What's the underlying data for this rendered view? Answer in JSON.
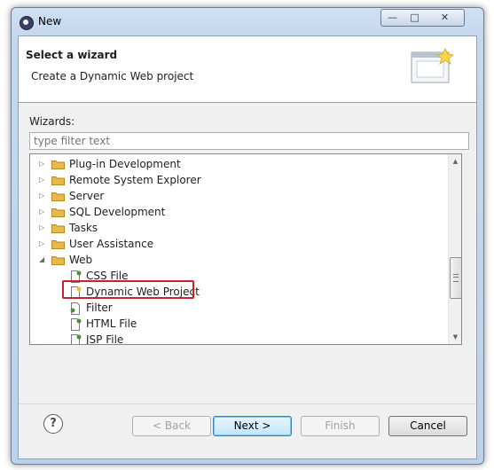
{
  "window": {
    "title": "New"
  },
  "header": {
    "title": "Select a wizard",
    "description": "Create a Dynamic Web project"
  },
  "wizards_label": "Wizards:",
  "filter": {
    "placeholder": "type filter text",
    "value": ""
  },
  "tree": {
    "items": [
      {
        "label": "Plug-in Development",
        "type": "folder",
        "expanded": false
      },
      {
        "label": "Remote System Explorer",
        "type": "folder",
        "expanded": false
      },
      {
        "label": "Server",
        "type": "folder",
        "expanded": false
      },
      {
        "label": "SQL Development",
        "type": "folder",
        "expanded": false
      },
      {
        "label": "Tasks",
        "type": "folder",
        "expanded": false
      },
      {
        "label": "User Assistance",
        "type": "folder",
        "expanded": false
      },
      {
        "label": "Web",
        "type": "folder",
        "expanded": true
      },
      {
        "label": "CSS File",
        "type": "file",
        "icon": "css-file-icon"
      },
      {
        "label": "Dynamic Web Project",
        "type": "file",
        "icon": "web-project-icon",
        "selected": true
      },
      {
        "label": "Filter",
        "type": "file",
        "icon": "filter-icon"
      },
      {
        "label": "HTML File",
        "type": "file",
        "icon": "html-file-icon"
      },
      {
        "label": "JSP File",
        "type": "file",
        "icon": "jsp-file-icon"
      }
    ]
  },
  "buttons": {
    "help": "?",
    "back": "< Back",
    "next": "Next >",
    "finish": "Finish",
    "cancel": "Cancel"
  },
  "colors": {
    "highlight_border": "#c8212f",
    "folder": "#e8b94a"
  }
}
